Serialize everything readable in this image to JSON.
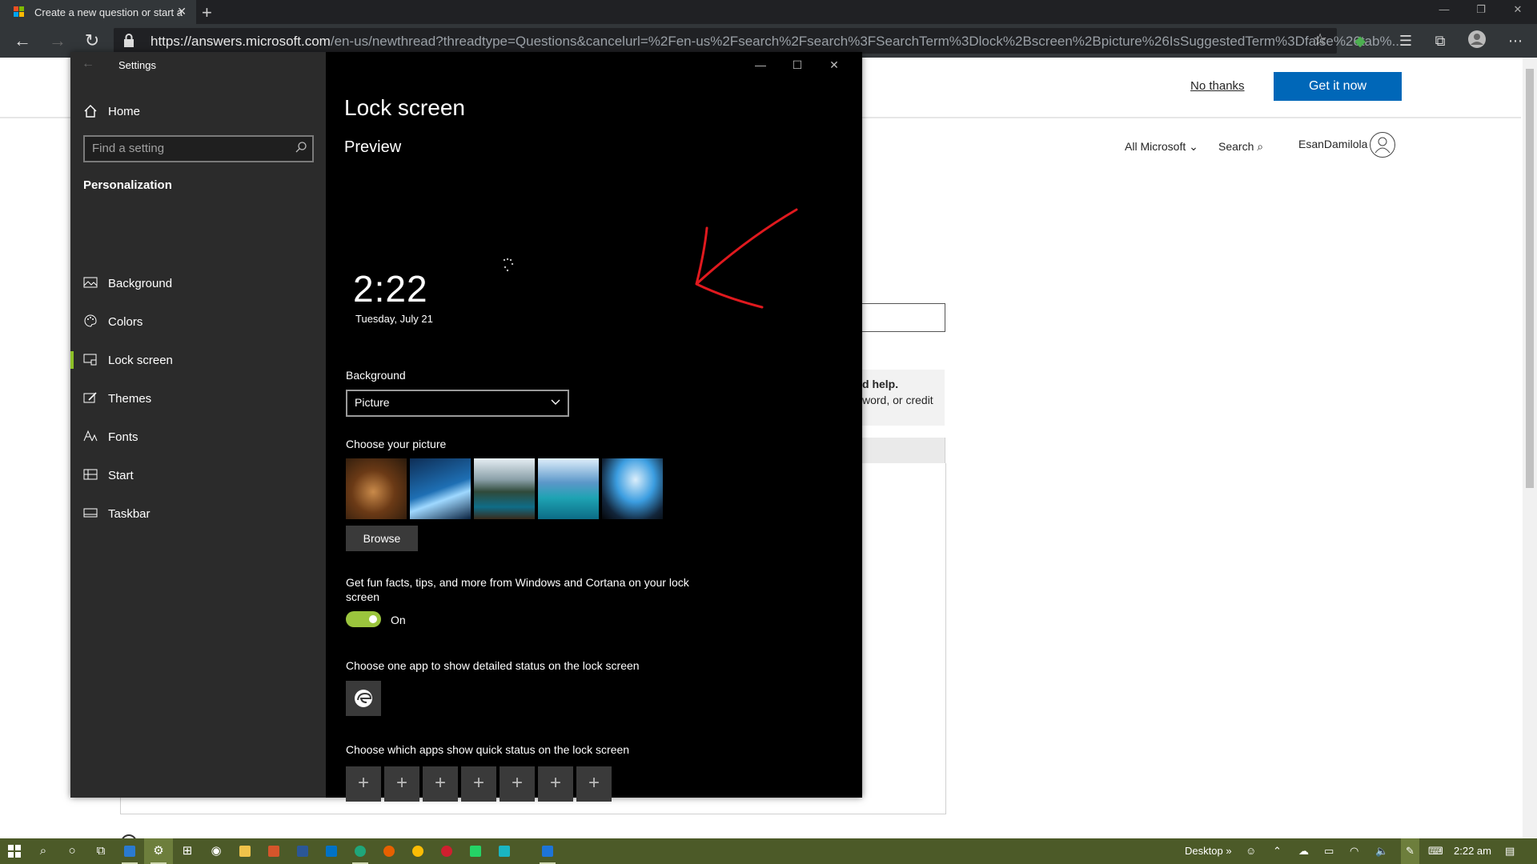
{
  "browser": {
    "tab_title": "Create a new question or start a",
    "url_host": "https://answers.microsoft.com",
    "url_path": "/en-us/newthread?threadtype=Questions&cancelurl=%2Fen-us%2Fsearch%2Fsearch%3FSearchTerm%3Dlock%2Bscreen%2Bpicture%26IsSuggestedTerm%3Dfalse%26tab%..."
  },
  "webpage": {
    "no_thanks": "No thanks",
    "get_it_now": "Get it now",
    "all_microsoft": "All Microsoft",
    "search": "Search",
    "user": "EsanDamilola",
    "help_text": "d help.",
    "help_text2": "word, or credit"
  },
  "settings": {
    "app_title": "Settings",
    "home": "Home",
    "search_placeholder": "Find a setting",
    "section": "Personalization",
    "nav": [
      {
        "label": "Background",
        "icon": "picture-icon"
      },
      {
        "label": "Colors",
        "icon": "palette-icon"
      },
      {
        "label": "Lock screen",
        "icon": "lock-screen-icon",
        "active": true
      },
      {
        "label": "Themes",
        "icon": "themes-icon"
      },
      {
        "label": "Fonts",
        "icon": "fonts-icon"
      },
      {
        "label": "Start",
        "icon": "start-icon"
      },
      {
        "label": "Taskbar",
        "icon": "taskbar-icon"
      }
    ],
    "page_title": "Lock screen",
    "preview_heading": "Preview",
    "preview_time": "2:22",
    "preview_date": "Tuesday, July 21",
    "background_label": "Background",
    "background_value": "Picture",
    "choose_picture_label": "Choose your picture",
    "browse_button": "Browse",
    "fun_facts_text": "Get fun facts, tips, and more from Windows and Cortana on your lock screen",
    "toggle_state": "On",
    "detailed_status_label": "Choose one app to show detailed status on the lock screen",
    "quick_status_label": "Choose which apps show quick status on the lock screen",
    "quick_status_plus": [
      "+",
      "+",
      "+",
      "+",
      "+",
      "+",
      "+"
    ],
    "accent_color": "#8cbf26"
  },
  "taskbar": {
    "desktop_label": "Desktop",
    "time": "2:22 am"
  }
}
